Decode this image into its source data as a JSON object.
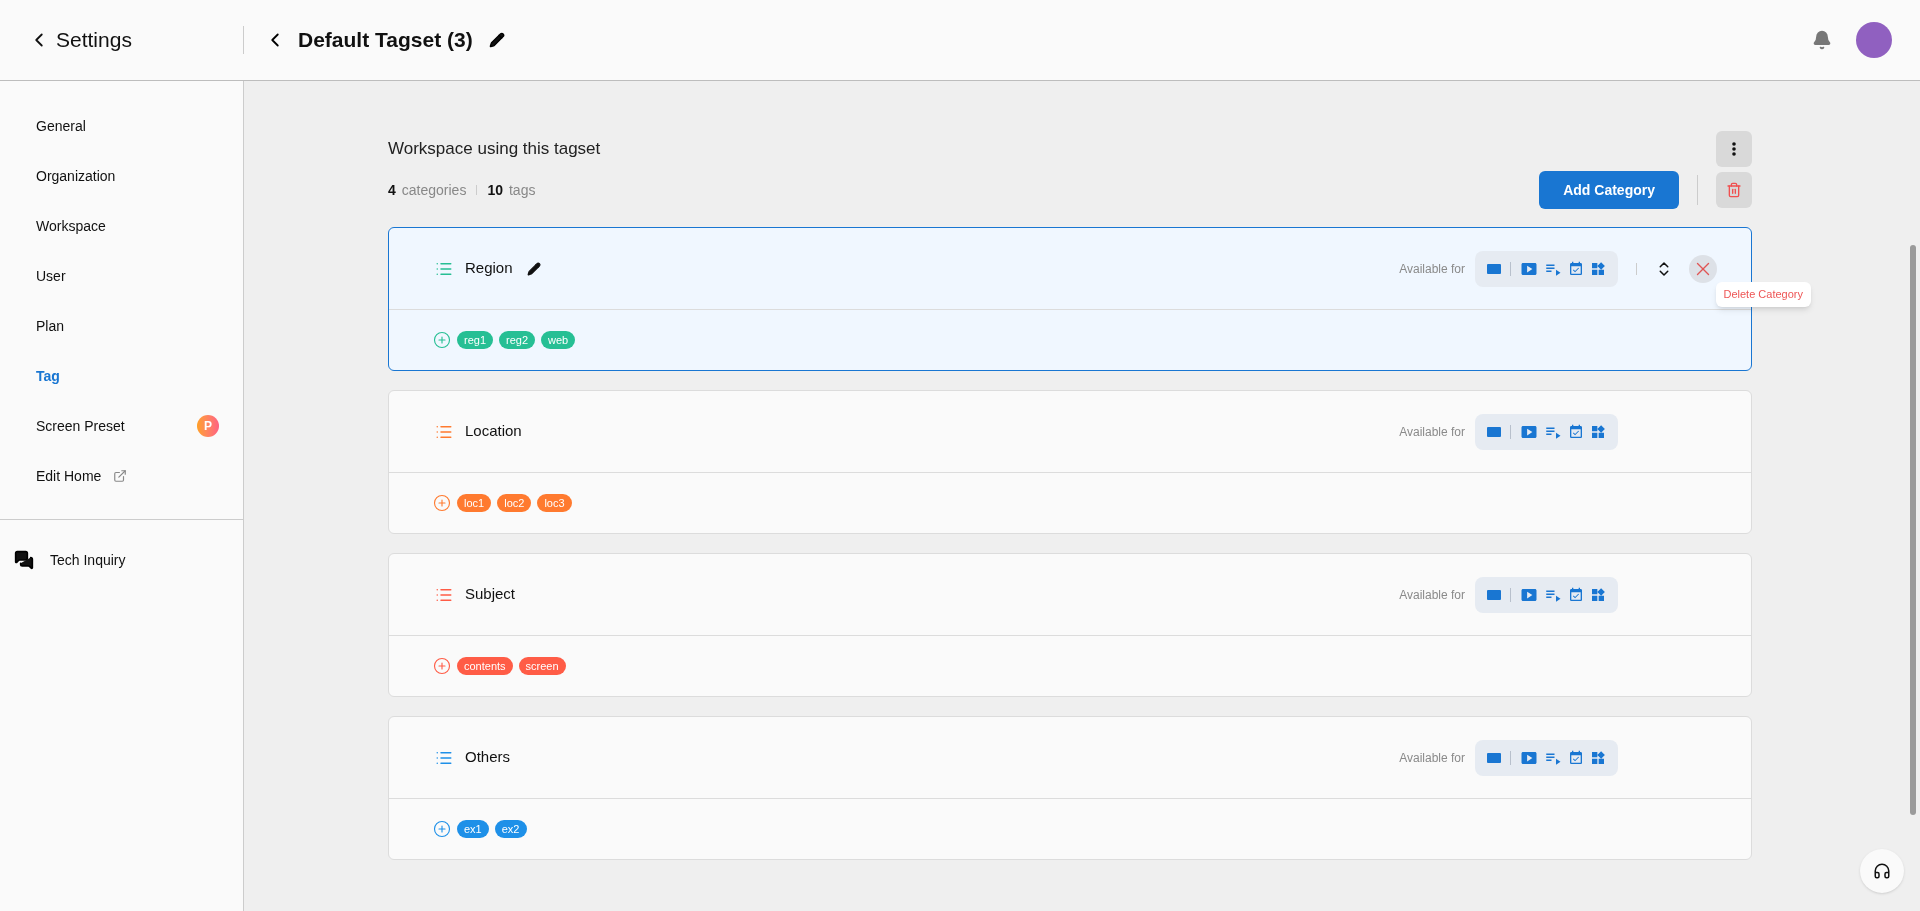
{
  "header": {
    "back_label": "Settings",
    "title": "Default Tagset (3)"
  },
  "sidebar": {
    "items": [
      {
        "label": "General",
        "selected": false,
        "kind": "plain"
      },
      {
        "label": "Organization",
        "selected": false,
        "kind": "plain"
      },
      {
        "label": "Workspace",
        "selected": false,
        "kind": "plain"
      },
      {
        "label": "User",
        "selected": false,
        "kind": "plain"
      },
      {
        "label": "Plan",
        "selected": false,
        "kind": "plain"
      },
      {
        "label": "Tag",
        "selected": true,
        "kind": "plain"
      },
      {
        "label": "Screen Preset",
        "selected": false,
        "kind": "badge",
        "badge": "P"
      },
      {
        "label": "Edit Home",
        "selected": false,
        "kind": "external"
      }
    ],
    "footer_item": "Tech Inquiry"
  },
  "content": {
    "title": "Workspace using this tagset",
    "category_count": "4",
    "category_label": "categories",
    "tag_count": "10",
    "tag_label": "tags",
    "add_button": "Add Category",
    "categories": [
      {
        "name": "Region",
        "color": "#26bf94",
        "selected": true,
        "available_label": "Available for",
        "tags": [
          "reg1",
          "reg2",
          "web"
        ],
        "tooltip": "Delete Category"
      },
      {
        "name": "Location",
        "color": "#ff7a2f",
        "selected": false,
        "available_label": "Available for",
        "tags": [
          "loc1",
          "loc2",
          "loc3"
        ]
      },
      {
        "name": "Subject",
        "color": "#ff5c46",
        "selected": false,
        "available_label": "Available for",
        "tags": [
          "contents",
          "screen"
        ]
      },
      {
        "name": "Others",
        "color": "#1e90e8",
        "selected": false,
        "available_label": "Available for",
        "tags": [
          "ex1",
          "ex2"
        ]
      }
    ]
  }
}
